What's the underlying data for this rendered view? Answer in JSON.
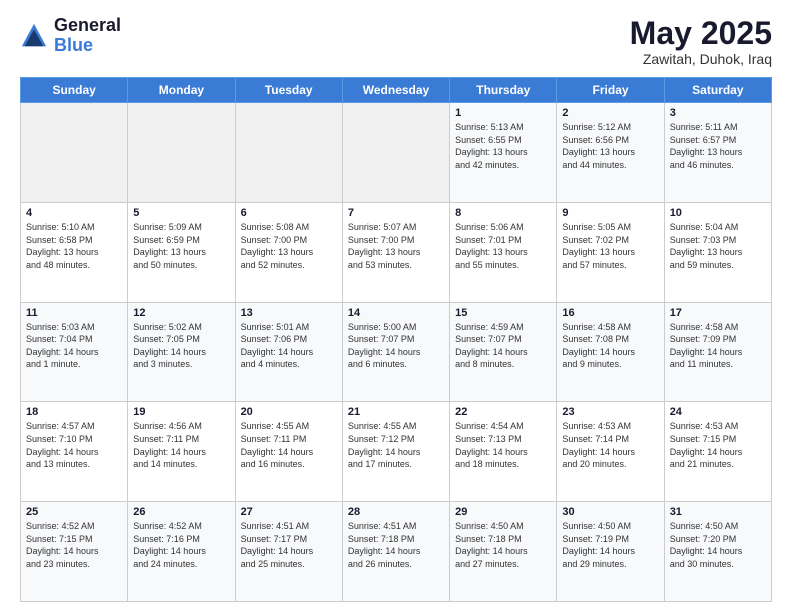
{
  "header": {
    "logo_general": "General",
    "logo_blue": "Blue",
    "month_title": "May 2025",
    "location": "Zawitah, Duhok, Iraq"
  },
  "days_of_week": [
    "Sunday",
    "Monday",
    "Tuesday",
    "Wednesday",
    "Thursday",
    "Friday",
    "Saturday"
  ],
  "weeks": [
    [
      {
        "day": "",
        "info": ""
      },
      {
        "day": "",
        "info": ""
      },
      {
        "day": "",
        "info": ""
      },
      {
        "day": "",
        "info": ""
      },
      {
        "day": "1",
        "info": "Sunrise: 5:13 AM\nSunset: 6:55 PM\nDaylight: 13 hours\nand 42 minutes."
      },
      {
        "day": "2",
        "info": "Sunrise: 5:12 AM\nSunset: 6:56 PM\nDaylight: 13 hours\nand 44 minutes."
      },
      {
        "day": "3",
        "info": "Sunrise: 5:11 AM\nSunset: 6:57 PM\nDaylight: 13 hours\nand 46 minutes."
      }
    ],
    [
      {
        "day": "4",
        "info": "Sunrise: 5:10 AM\nSunset: 6:58 PM\nDaylight: 13 hours\nand 48 minutes."
      },
      {
        "day": "5",
        "info": "Sunrise: 5:09 AM\nSunset: 6:59 PM\nDaylight: 13 hours\nand 50 minutes."
      },
      {
        "day": "6",
        "info": "Sunrise: 5:08 AM\nSunset: 7:00 PM\nDaylight: 13 hours\nand 52 minutes."
      },
      {
        "day": "7",
        "info": "Sunrise: 5:07 AM\nSunset: 7:00 PM\nDaylight: 13 hours\nand 53 minutes."
      },
      {
        "day": "8",
        "info": "Sunrise: 5:06 AM\nSunset: 7:01 PM\nDaylight: 13 hours\nand 55 minutes."
      },
      {
        "day": "9",
        "info": "Sunrise: 5:05 AM\nSunset: 7:02 PM\nDaylight: 13 hours\nand 57 minutes."
      },
      {
        "day": "10",
        "info": "Sunrise: 5:04 AM\nSunset: 7:03 PM\nDaylight: 13 hours\nand 59 minutes."
      }
    ],
    [
      {
        "day": "11",
        "info": "Sunrise: 5:03 AM\nSunset: 7:04 PM\nDaylight: 14 hours\nand 1 minute."
      },
      {
        "day": "12",
        "info": "Sunrise: 5:02 AM\nSunset: 7:05 PM\nDaylight: 14 hours\nand 3 minutes."
      },
      {
        "day": "13",
        "info": "Sunrise: 5:01 AM\nSunset: 7:06 PM\nDaylight: 14 hours\nand 4 minutes."
      },
      {
        "day": "14",
        "info": "Sunrise: 5:00 AM\nSunset: 7:07 PM\nDaylight: 14 hours\nand 6 minutes."
      },
      {
        "day": "15",
        "info": "Sunrise: 4:59 AM\nSunset: 7:07 PM\nDaylight: 14 hours\nand 8 minutes."
      },
      {
        "day": "16",
        "info": "Sunrise: 4:58 AM\nSunset: 7:08 PM\nDaylight: 14 hours\nand 9 minutes."
      },
      {
        "day": "17",
        "info": "Sunrise: 4:58 AM\nSunset: 7:09 PM\nDaylight: 14 hours\nand 11 minutes."
      }
    ],
    [
      {
        "day": "18",
        "info": "Sunrise: 4:57 AM\nSunset: 7:10 PM\nDaylight: 14 hours\nand 13 minutes."
      },
      {
        "day": "19",
        "info": "Sunrise: 4:56 AM\nSunset: 7:11 PM\nDaylight: 14 hours\nand 14 minutes."
      },
      {
        "day": "20",
        "info": "Sunrise: 4:55 AM\nSunset: 7:11 PM\nDaylight: 14 hours\nand 16 minutes."
      },
      {
        "day": "21",
        "info": "Sunrise: 4:55 AM\nSunset: 7:12 PM\nDaylight: 14 hours\nand 17 minutes."
      },
      {
        "day": "22",
        "info": "Sunrise: 4:54 AM\nSunset: 7:13 PM\nDaylight: 14 hours\nand 18 minutes."
      },
      {
        "day": "23",
        "info": "Sunrise: 4:53 AM\nSunset: 7:14 PM\nDaylight: 14 hours\nand 20 minutes."
      },
      {
        "day": "24",
        "info": "Sunrise: 4:53 AM\nSunset: 7:15 PM\nDaylight: 14 hours\nand 21 minutes."
      }
    ],
    [
      {
        "day": "25",
        "info": "Sunrise: 4:52 AM\nSunset: 7:15 PM\nDaylight: 14 hours\nand 23 minutes."
      },
      {
        "day": "26",
        "info": "Sunrise: 4:52 AM\nSunset: 7:16 PM\nDaylight: 14 hours\nand 24 minutes."
      },
      {
        "day": "27",
        "info": "Sunrise: 4:51 AM\nSunset: 7:17 PM\nDaylight: 14 hours\nand 25 minutes."
      },
      {
        "day": "28",
        "info": "Sunrise: 4:51 AM\nSunset: 7:18 PM\nDaylight: 14 hours\nand 26 minutes."
      },
      {
        "day": "29",
        "info": "Sunrise: 4:50 AM\nSunset: 7:18 PM\nDaylight: 14 hours\nand 27 minutes."
      },
      {
        "day": "30",
        "info": "Sunrise: 4:50 AM\nSunset: 7:19 PM\nDaylight: 14 hours\nand 29 minutes."
      },
      {
        "day": "31",
        "info": "Sunrise: 4:50 AM\nSunset: 7:20 PM\nDaylight: 14 hours\nand 30 minutes."
      }
    ]
  ]
}
